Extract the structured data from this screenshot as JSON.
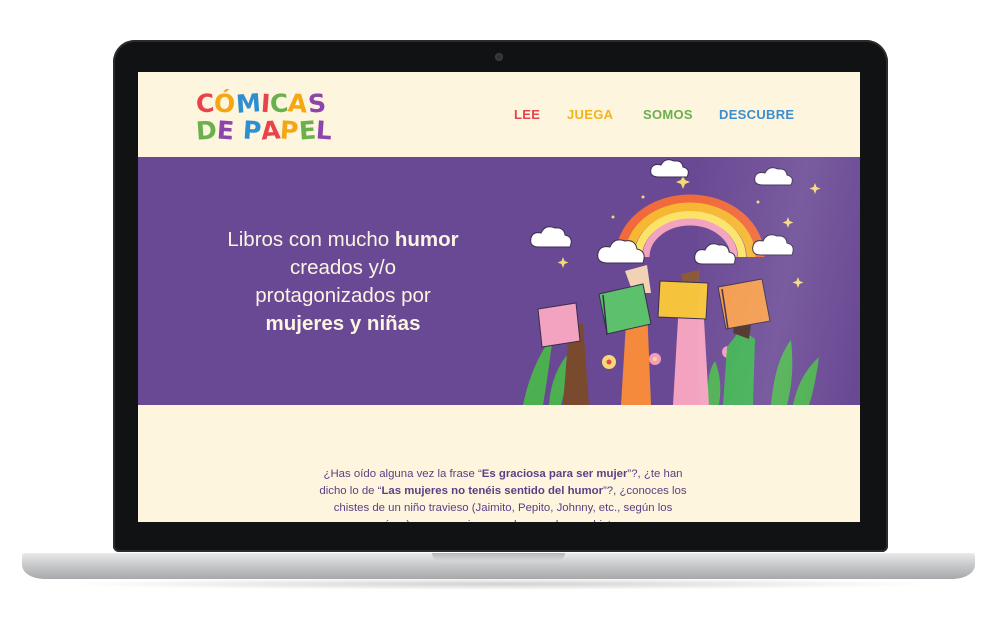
{
  "logo": {
    "line1": [
      "C",
      "Ó",
      "M",
      "I",
      "C",
      "A",
      "S"
    ],
    "line2": [
      "D",
      "E",
      " ",
      "P",
      "A",
      "P",
      "E",
      "L"
    ],
    "line1_colors": [
      "#e8434a",
      "#f3a712",
      "#2f8ecf",
      "#e8434a",
      "#6ab04c",
      "#f3a712",
      "#8e44ad"
    ],
    "line2_colors": [
      "#6ab04c",
      "#8e44ad",
      "#8e44ad",
      "#2f8ecf",
      "#e8434a",
      "#f3a712",
      "#6ab04c",
      "#8e44ad"
    ]
  },
  "nav": {
    "lee": "LEE",
    "juega": "JUEGA",
    "somos": "SOMOS",
    "descubre": "DESCUBRE"
  },
  "colors": {
    "background": "#fdf5dd",
    "hero": "#6a4994",
    "lee": "#e8434a",
    "juega": "#f3b31b",
    "somos": "#6ab04c",
    "descubre": "#3b8fd0",
    "text": "#5b3f86"
  },
  "hero": {
    "p1": "Libros con mucho ",
    "b1": "humor",
    "p2": "creados y/o",
    "p3": "protagonizados por",
    "b2": "mujeres y niñas"
  },
  "intro": {
    "t1": "¿Has oído alguna vez la frase “",
    "b1": "Es graciosa para ser mujer",
    "t2": "”?, ¿te han dicho lo de “",
    "b2": "Las mujeres no tenéis sentido del humor",
    "t3": "”?, ¿conoces los chistes de un niño travieso (Jaimito, Pepito, Johnny, etc., según los países), pero eres incapaz de recordar un chiste en"
  }
}
